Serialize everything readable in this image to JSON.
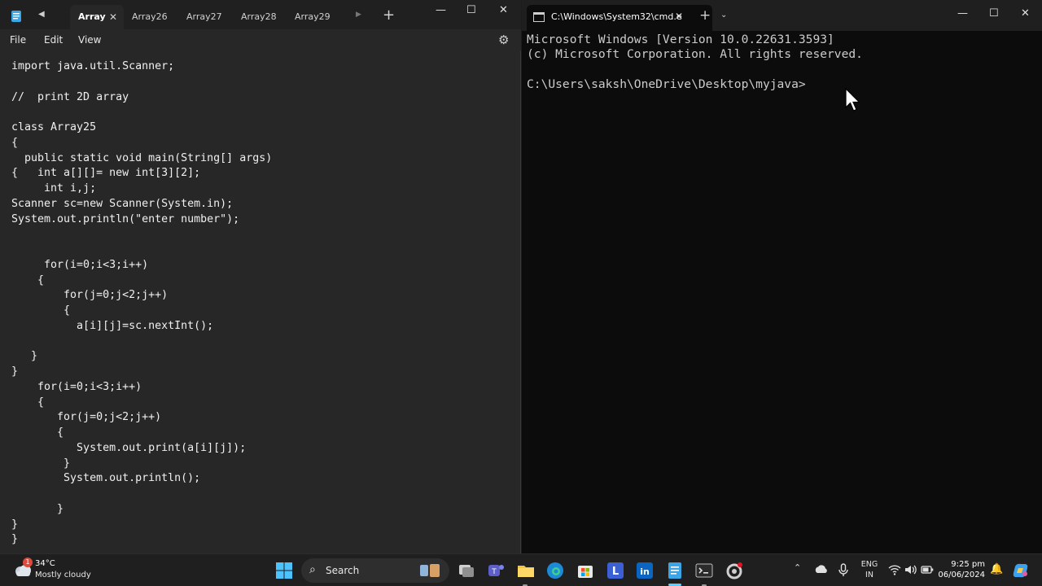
{
  "notepad": {
    "tabs": [
      {
        "label": "Array",
        "active": true
      },
      {
        "label": "Array26",
        "active": false
      },
      {
        "label": "Array27",
        "active": false
      },
      {
        "label": "Array28",
        "active": false
      },
      {
        "label": "Array29",
        "active": false
      }
    ],
    "tab_close_glyph": "✕",
    "new_tab_glyph": "+",
    "scroll_left_glyph": "◀",
    "scroll_right_glyph": "▶",
    "menu": {
      "file": "File",
      "edit": "Edit",
      "view": "View"
    },
    "window_controls": {
      "minimize": "—",
      "maximize": "☐",
      "close": "✕"
    },
    "settings_glyph": "⚙",
    "code_lines": [
      "import java.util.Scanner;",
      "",
      "//  print 2D array",
      "",
      "class Array25",
      "{",
      "  public static void main(String[] args)",
      "{   int a[][]= new int[3][2];",
      "     int i,j;",
      "Scanner sc=new Scanner(System.in);",
      "System.out.println(\"enter number\");",
      "",
      "",
      "     for(i=0;i<3;i++)",
      "    {",
      "        for(j=0;j<2;j++)",
      "        {",
      "          a[i][j]=sc.nextInt();",
      "",
      "   }",
      "}",
      "    for(i=0;i<3;i++)",
      "    {",
      "       for(j=0;j<2;j++)",
      "       {",
      "          System.out.print(a[i][j]);",
      "        }",
      "        System.out.println();",
      "",
      "       }",
      "}",
      "}"
    ]
  },
  "terminal": {
    "tab_title": "C:\\Windows\\System32\\cmd.e",
    "tab_close_glyph": "✕",
    "new_tab_glyph": "+",
    "dropdown_glyph": "⌄",
    "window_controls": {
      "minimize": "—",
      "maximize": "☐",
      "close": "✕"
    },
    "lines": [
      "Microsoft Windows [Version 10.0.22631.3593]",
      "(c) Microsoft Corporation. All rights reserved.",
      "",
      "C:\\Users\\saksh\\OneDrive\\Desktop\\myjava>"
    ]
  },
  "taskbar": {
    "weather": {
      "temp": "34°C",
      "desc": "Mostly cloudy",
      "badge": "1"
    },
    "search_label": "Search",
    "search_glyph": "⌕",
    "tray_up_glyph": "⌃",
    "language": {
      "line1": "ENG",
      "line2": "IN"
    },
    "clock": {
      "time": "9:25 pm",
      "date": "06/06/2024"
    },
    "notification_glyph": "🔔",
    "colors": {
      "accent": "#60cdff",
      "background": "#1f1f1f"
    }
  }
}
